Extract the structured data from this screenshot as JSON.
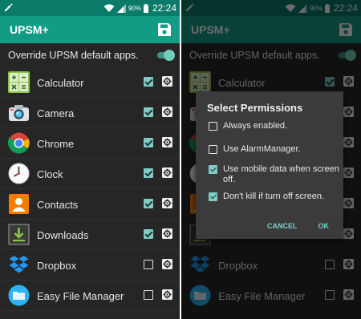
{
  "status_bar": {
    "battery": "90%",
    "time": "22:24"
  },
  "app_bar": {
    "title": "UPSM+"
  },
  "override": {
    "label": "Override UPSM default apps.",
    "enabled": true
  },
  "apps": [
    {
      "name": "Calculator",
      "icon": "calculator-icon",
      "checked": true
    },
    {
      "name": "Camera",
      "icon": "camera-icon",
      "checked": true
    },
    {
      "name": "Chrome",
      "icon": "chrome-icon",
      "checked": true
    },
    {
      "name": "Clock",
      "icon": "clock-icon",
      "checked": true
    },
    {
      "name": "Contacts",
      "icon": "contacts-icon",
      "checked": true
    },
    {
      "name": "Downloads",
      "icon": "downloads-icon",
      "checked": true
    },
    {
      "name": "Dropbox",
      "icon": "dropbox-icon",
      "checked": false
    },
    {
      "name": "Easy File Manager",
      "icon": "folder-icon",
      "checked": false
    }
  ],
  "dialog": {
    "title": "Select Permissions",
    "options": [
      {
        "label": "Always enabled.",
        "checked": false
      },
      {
        "label": "Use AlarmManager.",
        "checked": false
      },
      {
        "label": "Use mobile data when screen off.",
        "checked": true
      },
      {
        "label": "Don't kill if turn off screen.",
        "checked": true
      }
    ],
    "cancel_label": "CANCEL",
    "ok_label": "OK"
  },
  "colors": {
    "status_bar": "#0a7a69",
    "app_bar": "#129c86",
    "accent": "#80cbc4",
    "list_background": "#262626",
    "dialog_background": "#3b3b3b"
  }
}
